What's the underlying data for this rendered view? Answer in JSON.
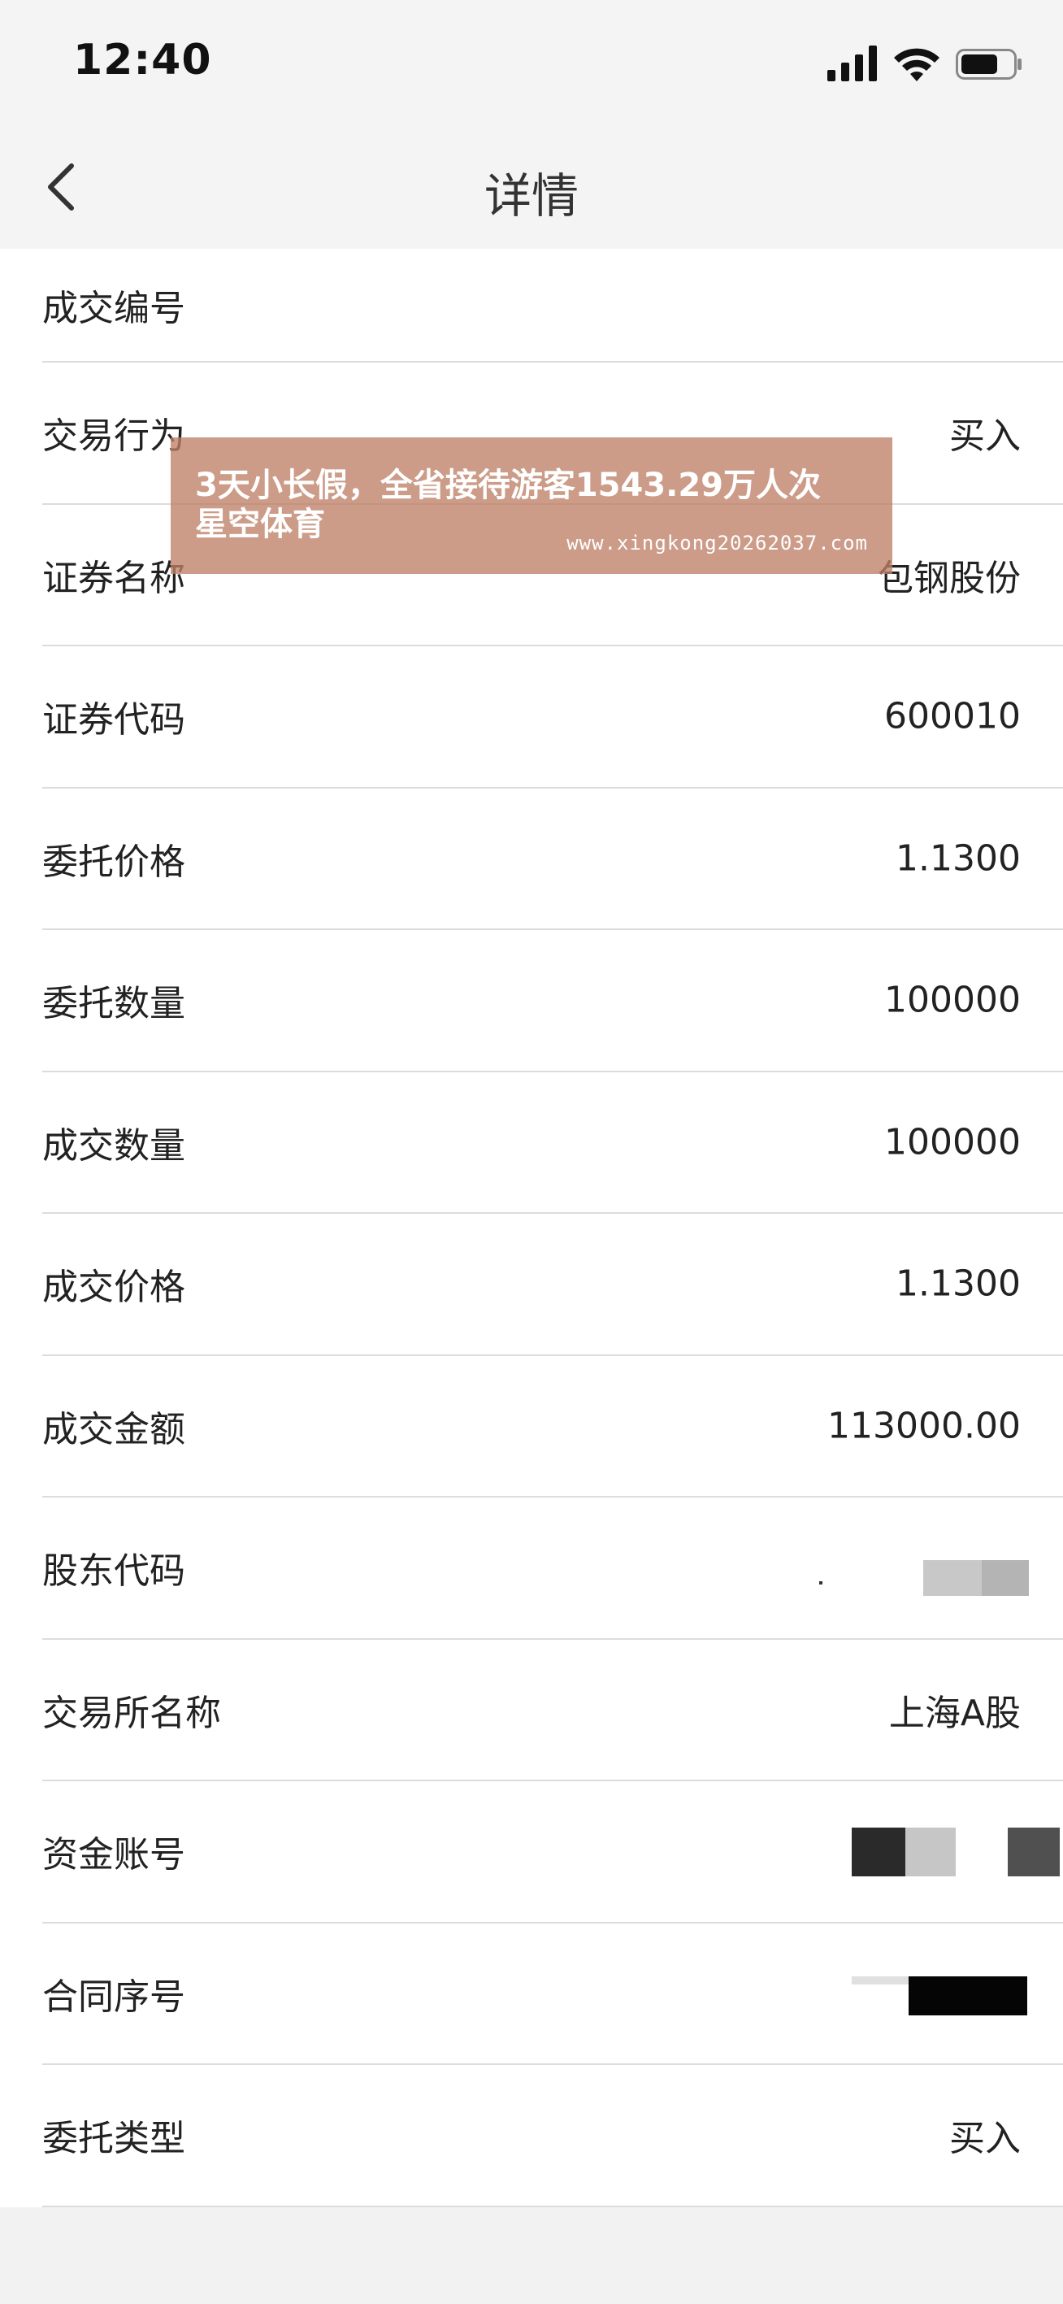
{
  "status_bar": {
    "time": "12:40",
    "icons": [
      "cellular-signal-icon",
      "wifi-icon",
      "battery-icon"
    ]
  },
  "nav": {
    "title": "详情",
    "back_icon": "chevron-left-icon"
  },
  "rows": [
    {
      "label": "成交编号",
      "value": ""
    },
    {
      "label": "交易行为",
      "value": "买入"
    },
    {
      "label": "证券名称",
      "value": "包钢股份"
    },
    {
      "label": "证券代码",
      "value": "600010"
    },
    {
      "label": "委托价格",
      "value": "1.1300"
    },
    {
      "label": "委托数量",
      "value": "100000"
    },
    {
      "label": "成交数量",
      "value": "100000"
    },
    {
      "label": "成交价格",
      "value": "1.1300"
    },
    {
      "label": "成交金额",
      "value": "113000.00"
    },
    {
      "label": "股东代码",
      "value": ""
    },
    {
      "label": "交易所名称",
      "value": "上海A股"
    },
    {
      "label": "资金账号",
      "value": ""
    },
    {
      "label": "合同序号",
      "value": ""
    },
    {
      "label": "委托类型",
      "value": "买入"
    }
  ],
  "watermark": {
    "line1": "3天小长假，全省接待游客1543.29万人次",
    "line2": "星空体育",
    "url": "www.xingkong20262037.com"
  },
  "colors": {
    "background": "#f2f2f2",
    "list_background": "#ffffff",
    "divider": "#dcdcdc",
    "watermark": "#be8068"
  }
}
